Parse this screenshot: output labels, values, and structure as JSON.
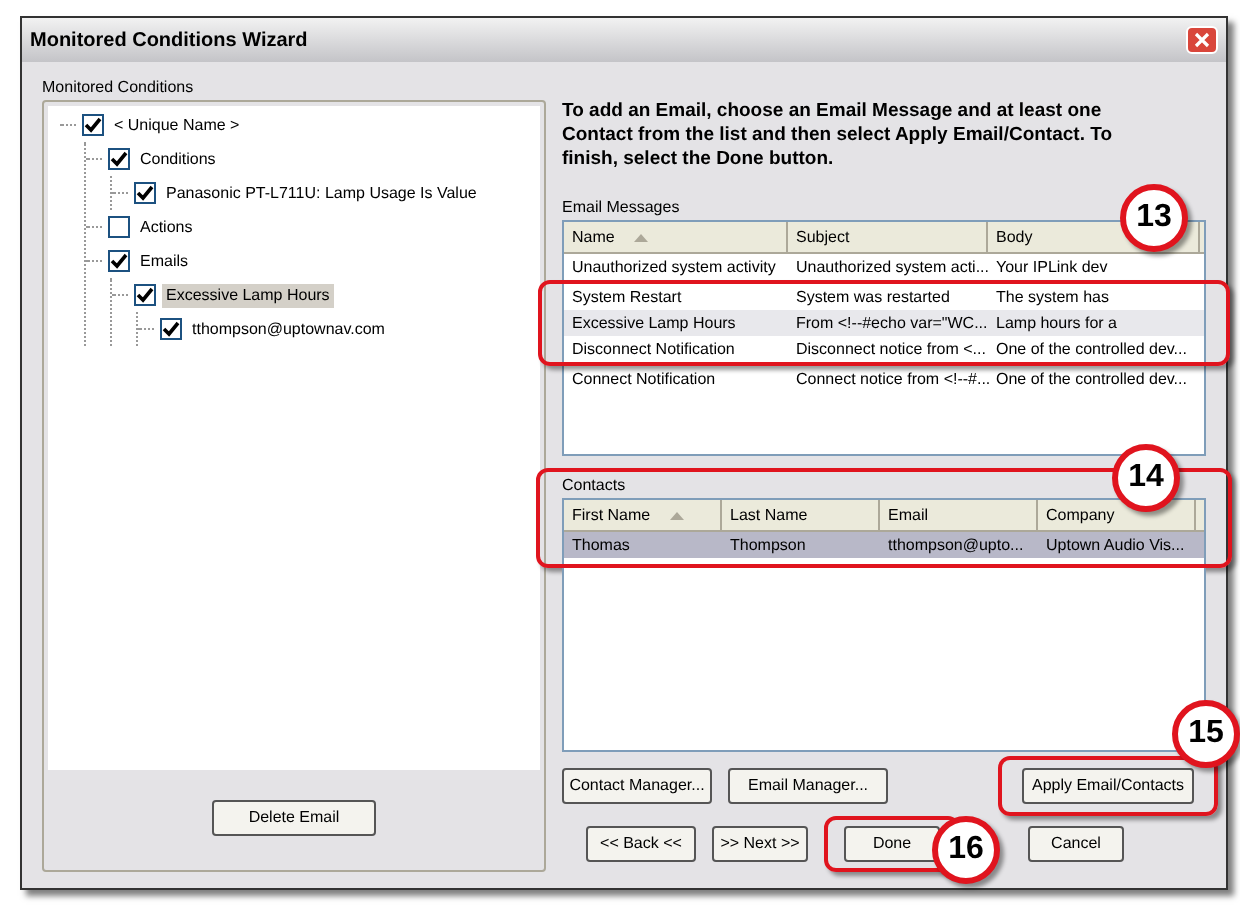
{
  "window": {
    "title": "Monitored Conditions Wizard"
  },
  "left": {
    "group_label": "Monitored Conditions",
    "tree": [
      {
        "label": "< Unique Name >",
        "checked": true,
        "selected": false,
        "children": [
          {
            "label": "Conditions",
            "checked": true,
            "selected": false,
            "children": [
              {
                "label": "Panasonic PT-L711U: Lamp Usage Is Value",
                "checked": true,
                "selected": false
              }
            ]
          },
          {
            "label": "Actions",
            "checked": false,
            "selected": false
          },
          {
            "label": "Emails",
            "checked": true,
            "selected": false,
            "children": [
              {
                "label": "Excessive Lamp Hours",
                "checked": true,
                "selected": true,
                "children": [
                  {
                    "label": "tthompson@uptownav.com",
                    "checked": true,
                    "selected": false
                  }
                ]
              }
            ]
          }
        ]
      }
    ],
    "delete_button": "Delete Email"
  },
  "instructions": "To add an Email, choose an Email Message and at least one Contact from the list and then select Apply Email/Contact. To finish, select the Done button.",
  "email_messages": {
    "label": "Email Messages",
    "columns": [
      {
        "label": "Name",
        "sorted": true
      },
      {
        "label": "Subject",
        "sorted": false
      },
      {
        "label": "Body",
        "sorted": false
      }
    ],
    "rows": [
      {
        "cells": [
          "Unauthorized system activity",
          "Unauthorized system acti...",
          "Your IPLink dev"
        ],
        "selected": false
      },
      {
        "cells": [
          "System Restart",
          "System was restarted",
          "The system has"
        ],
        "selected": false
      },
      {
        "cells": [
          "Excessive Lamp Hours",
          "From <!--#echo var=\"WC...",
          "Lamp hours for a"
        ],
        "selected": true
      },
      {
        "cells": [
          "Disconnect Notification",
          "Disconnect notice from <...",
          "One of the controlled dev..."
        ],
        "selected": false
      },
      {
        "cells": [
          "Connect Notification",
          "Connect notice from <!--#...",
          "One of the controlled dev..."
        ],
        "selected": false
      }
    ]
  },
  "contacts": {
    "label": "Contacts",
    "columns": [
      {
        "label": "First Name",
        "sorted": true
      },
      {
        "label": "Last Name",
        "sorted": false
      },
      {
        "label": "Email",
        "sorted": false
      },
      {
        "label": "Company",
        "sorted": false
      }
    ],
    "rows": [
      {
        "cells": [
          "Thomas",
          "Thompson",
          "tthompson@upto...",
          "Uptown Audio Vis..."
        ],
        "selected": true
      }
    ]
  },
  "manager_buttons": [
    "Contact Manager...",
    "Email Manager..."
  ],
  "apply_button": "Apply Email/Contacts",
  "nav_buttons": [
    "<< Back <<",
    ">> Next >>",
    "Done",
    "Cancel"
  ],
  "callouts": [
    {
      "label": "13"
    },
    {
      "label": "14"
    },
    {
      "label": "15"
    },
    {
      "label": "16"
    }
  ]
}
